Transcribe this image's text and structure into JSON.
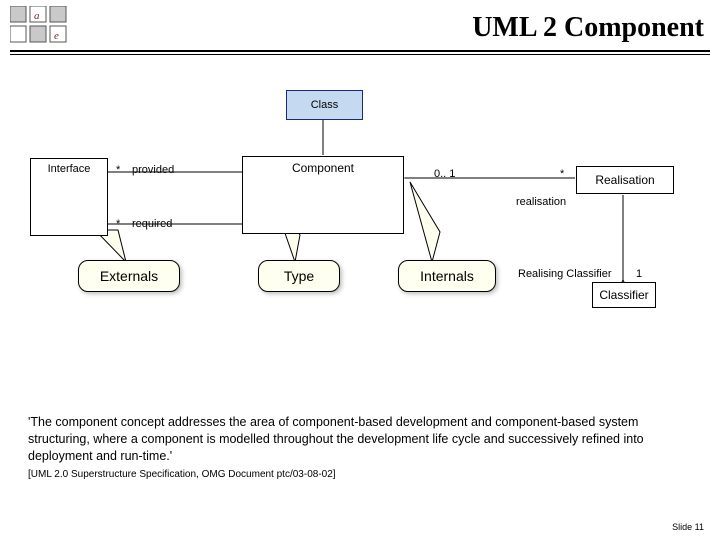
{
  "header": {
    "title": "UML 2 Component"
  },
  "classes": {
    "class": "Class",
    "interface": "Interface",
    "component": "Component",
    "realisation": "Realisation",
    "classifier": "Classifier"
  },
  "assoc": {
    "provided_star": "*",
    "provided_label": "provided",
    "required_star": "*",
    "required_label": "required",
    "comp_to_real_left": "0.. 1",
    "comp_to_real_right": "*",
    "realisation_label": "realisation",
    "classifier_role": "Realising Classifier",
    "classifier_mult": "1"
  },
  "callouts": {
    "externals": "Externals",
    "type": "Type",
    "internals": "Internals"
  },
  "body": {
    "quote": "'The component concept addresses the area of component-based development and component-based system structuring, where a component is modelled throughout the development life cycle and successively refined into deployment and run-time.'",
    "cite": "[UML 2.0 Superstructure Specification, OMG Document ptc/03-08-02]"
  },
  "footer": {
    "slide": "Slide 11"
  }
}
